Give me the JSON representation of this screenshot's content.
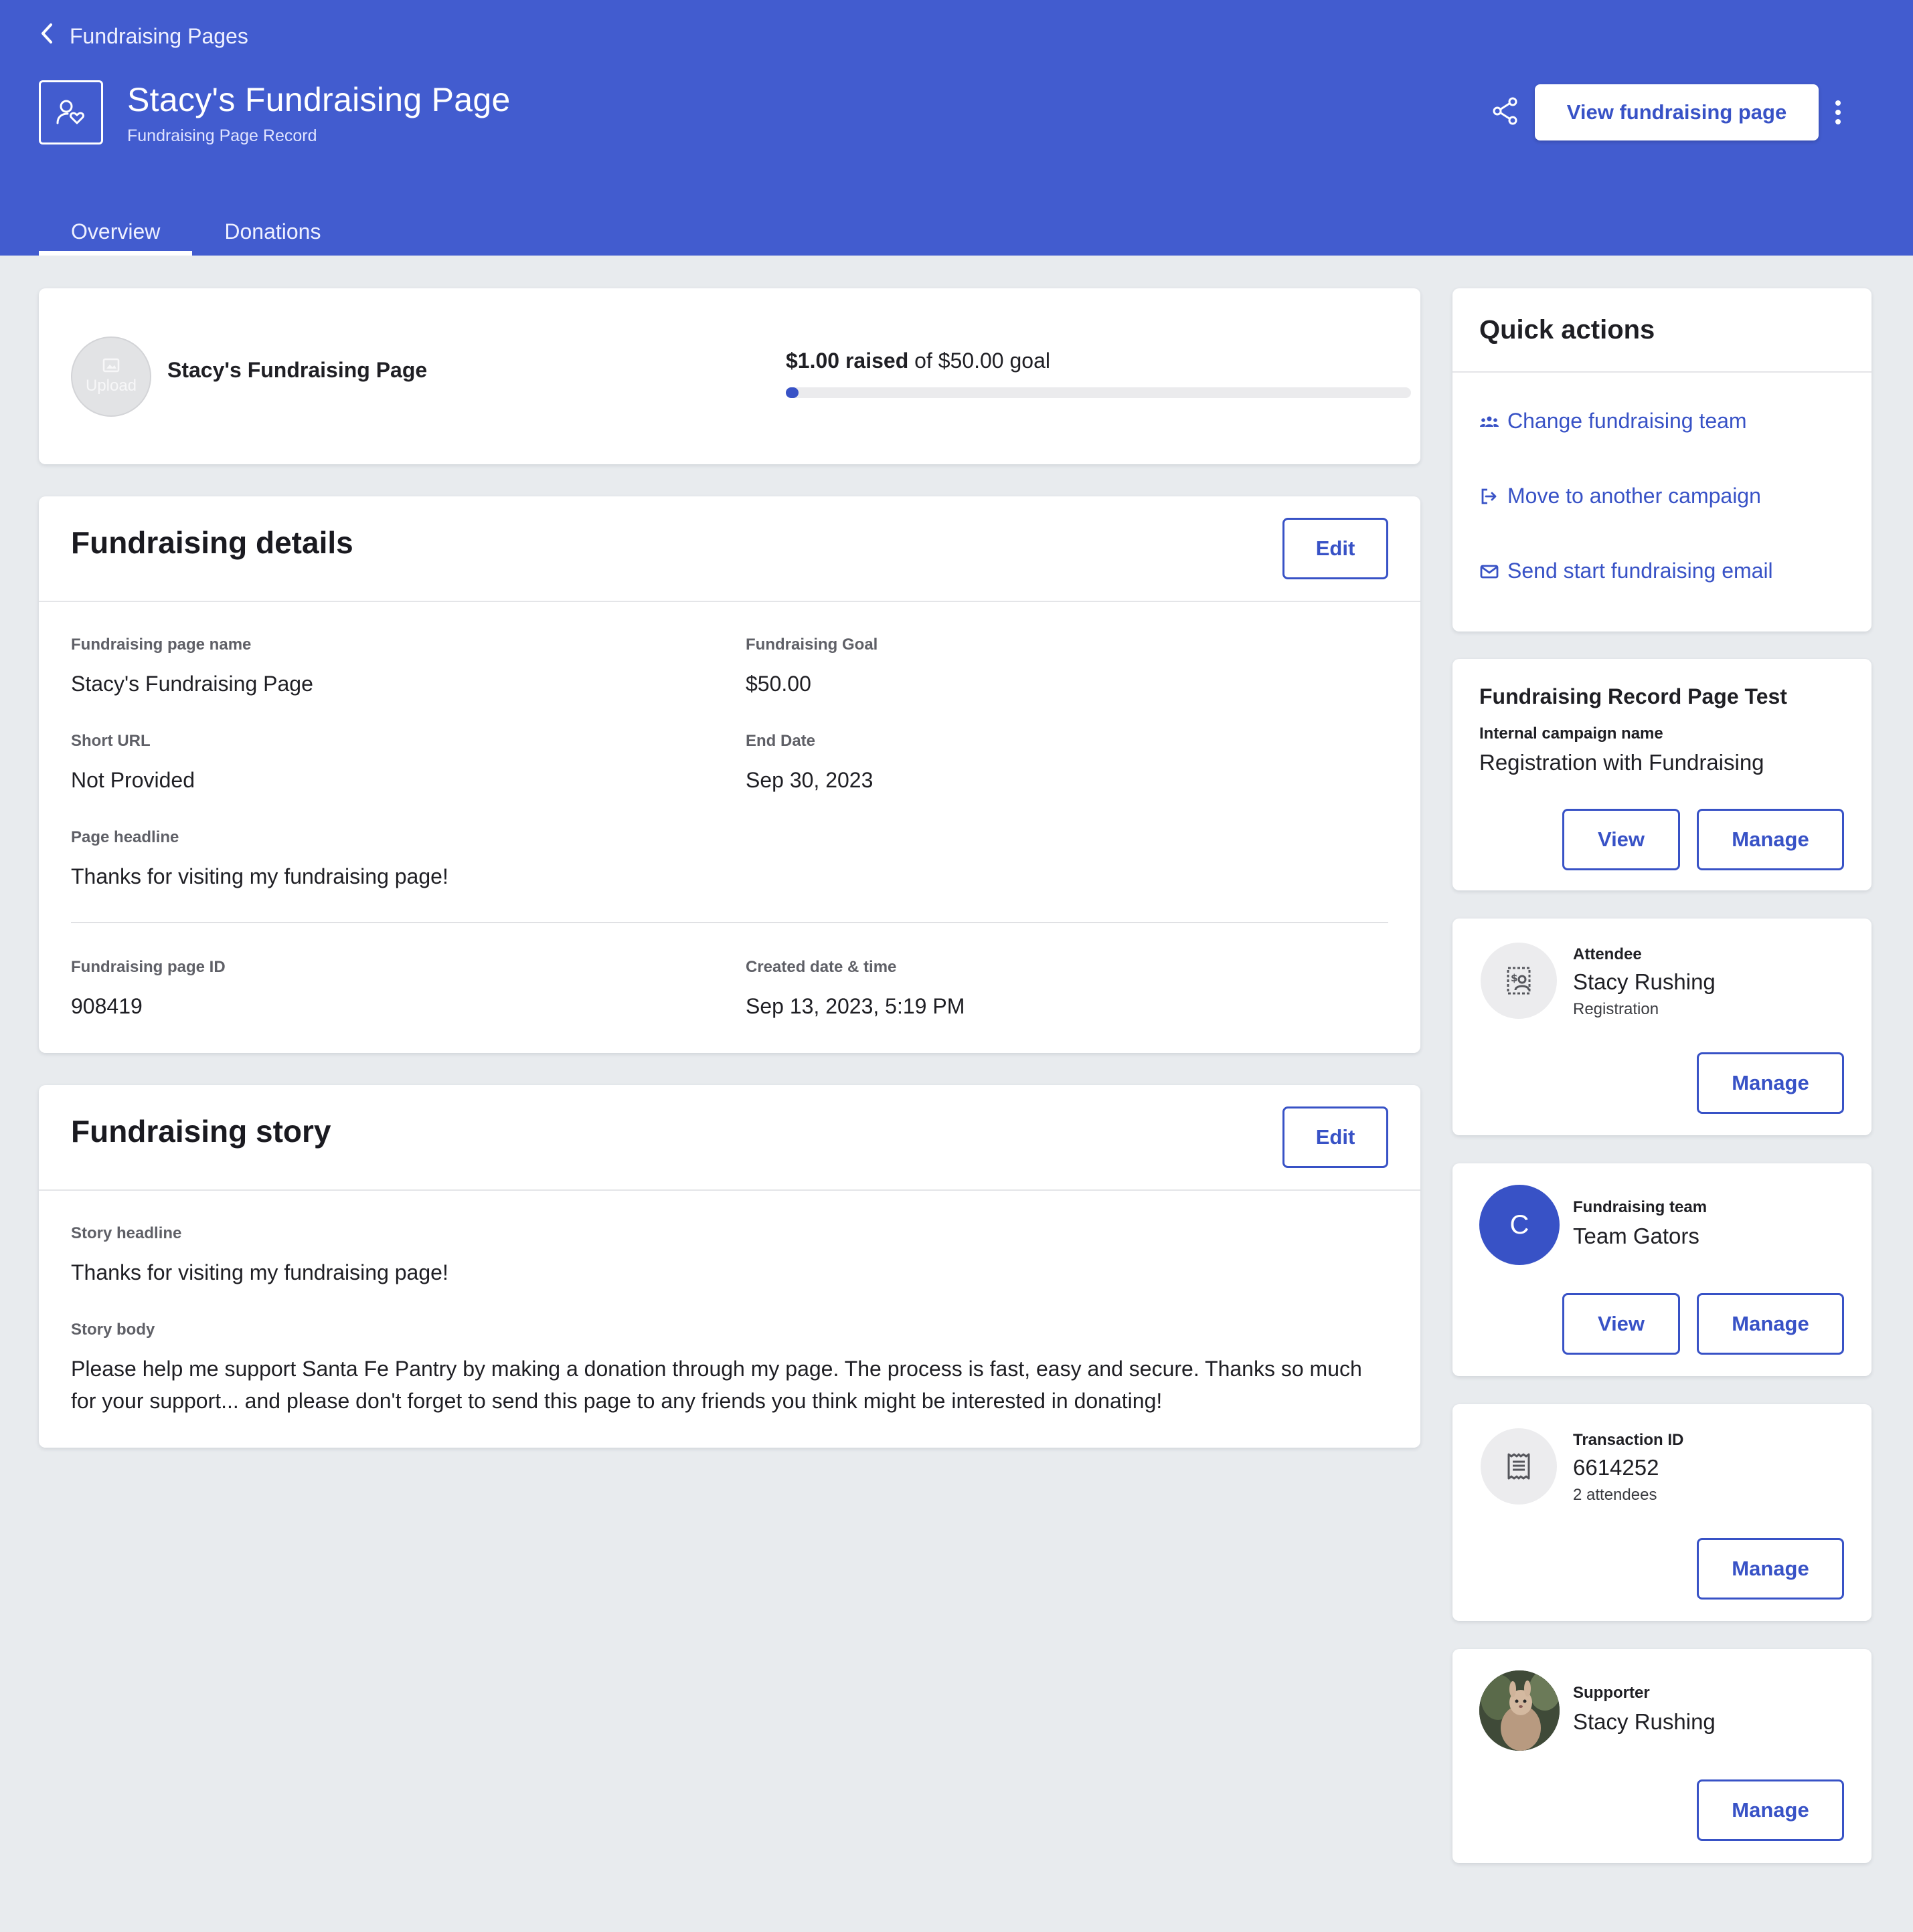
{
  "header": {
    "breadcrumb": "Fundraising Pages",
    "title": "Stacy's Fundraising Page",
    "subtitle": "Fundraising Page Record",
    "view_button": "View fundraising page",
    "tabs": [
      {
        "label": "Overview",
        "active": true
      },
      {
        "label": "Donations",
        "active": false
      }
    ],
    "accent_color": "#425ccf"
  },
  "summary": {
    "name": "Stacy's Fundraising Page",
    "upload_label": "Upload",
    "raised_amount": "$1.00 raised",
    "goal_text": "of $50.00 goal",
    "progress_fraction": 0.02
  },
  "details": {
    "title": "Fundraising details",
    "edit_label": "Edit",
    "fields": {
      "page_name_label": "Fundraising page name",
      "page_name": "Stacy's Fundraising Page",
      "goal_label": "Fundraising Goal",
      "goal": "$50.00",
      "short_url_label": "Short URL",
      "short_url": "Not Provided",
      "end_date_label": "End Date",
      "end_date": "Sep 30, 2023",
      "headline_label": "Page headline",
      "headline": "Thanks for visiting my fundraising page!",
      "page_id_label": "Fundraising page ID",
      "page_id": "908419",
      "created_label": "Created date & time",
      "created": "Sep 13, 2023, 5:19 PM"
    }
  },
  "story": {
    "title": "Fundraising story",
    "edit_label": "Edit",
    "headline_label": "Story headline",
    "headline": "Thanks for visiting my fundraising page!",
    "body_label": "Story body",
    "body": "Please help me support Santa Fe Pantry by making a donation through my page. The process is fast, easy and secure. Thanks so much for your support... and please don't forget to send this page to any friends you think might be interested in donating!"
  },
  "quick_actions": {
    "title": "Quick actions",
    "items": [
      {
        "label": "Change fundraising team",
        "icon": "team-icon"
      },
      {
        "label": "Move to another campaign",
        "icon": "move-icon"
      },
      {
        "label": "Send start fundraising email",
        "icon": "mail-icon"
      }
    ]
  },
  "campaign": {
    "title": "Fundraising Record Page Test",
    "internal_label": "Internal campaign name",
    "internal_value": "Registration with Fundraising",
    "view_label": "View",
    "manage_label": "Manage"
  },
  "attendee": {
    "label": "Attendee",
    "name": "Stacy Rushing",
    "sub": "Registration",
    "manage_label": "Manage"
  },
  "team": {
    "initial": "C",
    "label": "Fundraising team",
    "name": "Team Gators",
    "view_label": "View",
    "manage_label": "Manage"
  },
  "transaction": {
    "label": "Transaction ID",
    "id": "6614252",
    "sub": "2 attendees",
    "manage_label": "Manage"
  },
  "supporter": {
    "label": "Supporter",
    "name": "Stacy Rushing",
    "manage_label": "Manage"
  }
}
